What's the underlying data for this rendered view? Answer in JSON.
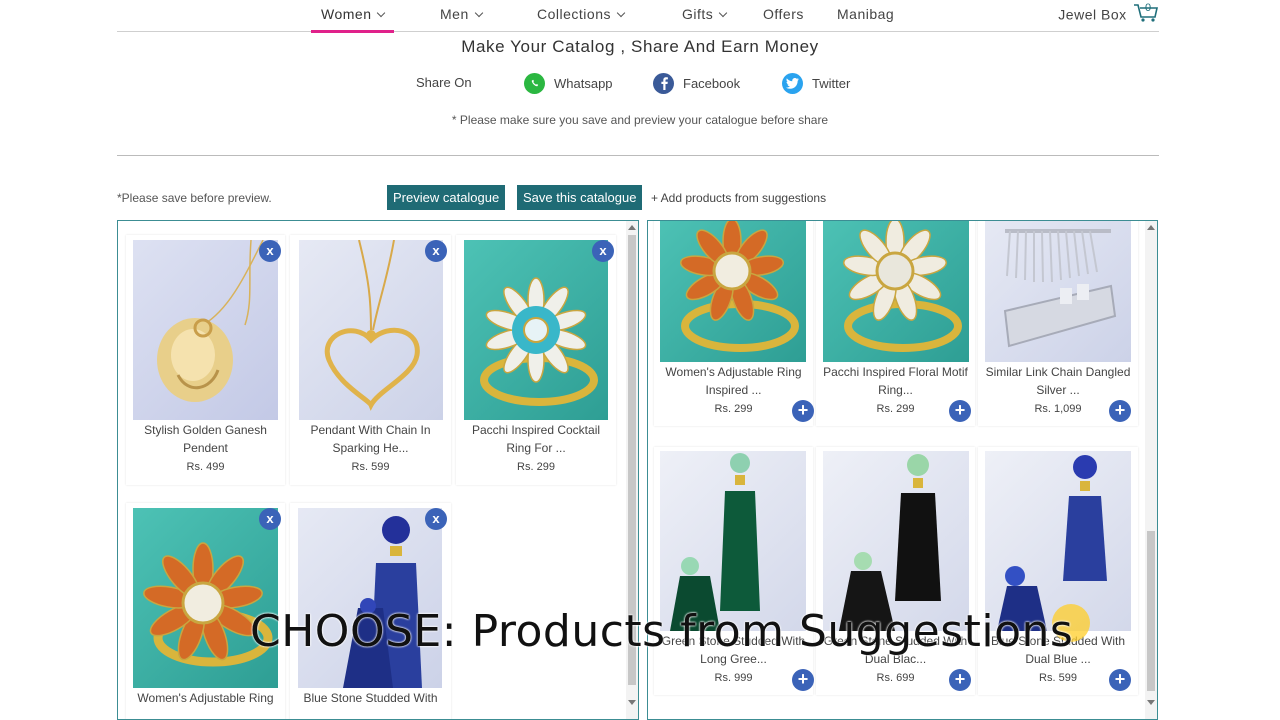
{
  "nav": {
    "items": [
      {
        "label": "Women",
        "dropdown": true,
        "active": true
      },
      {
        "label": "Men",
        "dropdown": true
      },
      {
        "label": "Collections",
        "dropdown": true
      },
      {
        "label": "Gifts",
        "dropdown": true
      },
      {
        "label": "Offers",
        "dropdown": false
      },
      {
        "label": "Manibag",
        "dropdown": false
      }
    ],
    "jewel_box": "Jewel Box",
    "cart_count": "0"
  },
  "page_title": "Make Your Catalog , Share And Earn Money",
  "share": {
    "label": "Share On",
    "whatsapp": "Whatsapp",
    "facebook": "Facebook",
    "twitter": "Twitter"
  },
  "note": "* Please make sure you save and preview your catalogue before share",
  "toolbar": {
    "save_note": "*Please save before preview.",
    "preview_label": "Preview catalogue",
    "save_label": "Save this catalogue",
    "add_label": "+ Add products from suggestions"
  },
  "catalogue": [
    {
      "name": "Stylish Golden Ganesh Pendent",
      "price": "Rs. 499"
    },
    {
      "name": "Pendant With Chain In Sparking He...",
      "price": "Rs. 599"
    },
    {
      "name": "Pacchi Inspired Cocktail Ring For ...",
      "price": "Rs. 299"
    },
    {
      "name": "Women's Adjustable Ring",
      "price": ""
    },
    {
      "name": "Blue Stone Studded With",
      "price": ""
    }
  ],
  "suggestions": [
    {
      "name": "Women's Adjustable Ring Inspired ...",
      "price": "Rs. 299"
    },
    {
      "name": "Pacchi Inspired Floral Motif Ring...",
      "price": "Rs. 299"
    },
    {
      "name": "Similar Link Chain Dangled Silver ...",
      "price": "Rs. 1,099"
    },
    {
      "name": "Green Stone Studded With Long Gree...",
      "price": "Rs. 999"
    },
    {
      "name": "Green Stone Studded With Dual Blac...",
      "price": "Rs. 699"
    },
    {
      "name": "Blue Stone Studded With Dual Blue ...",
      "price": "Rs. 599"
    }
  ],
  "caption": "CHOOSE: Products from Suggestions",
  "colors": {
    "accent": "#e0218a",
    "teal": "#1f6b75",
    "blue": "#3b63b8"
  }
}
